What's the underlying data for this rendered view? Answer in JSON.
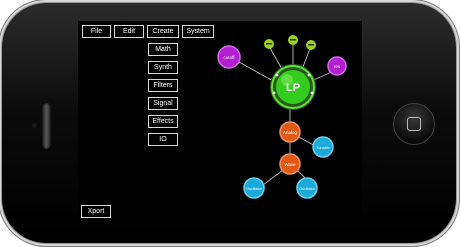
{
  "menu": {
    "file": "File",
    "edit": "Edit",
    "create": "Create",
    "system": "System"
  },
  "create_submenu": [
    "Math",
    "Synth",
    "Filters",
    "Signal",
    "Effects",
    "IO"
  ],
  "export_button": "Xport",
  "nodes": {
    "lp": "LP",
    "cutoff": "cutoff",
    "res": "res",
    "knob1": "",
    "knob2": "",
    "knob3": "",
    "analog": "Analog",
    "tuner": "Tunable",
    "wave": "Wave",
    "osc1": "Oscillator",
    "osc2": "Oscillator"
  },
  "colors": {
    "purple": "#b21fd1",
    "green": "#33cc1f",
    "lime": "#9bd21d",
    "orange": "#e15a14",
    "blue": "#1aa9d8"
  }
}
